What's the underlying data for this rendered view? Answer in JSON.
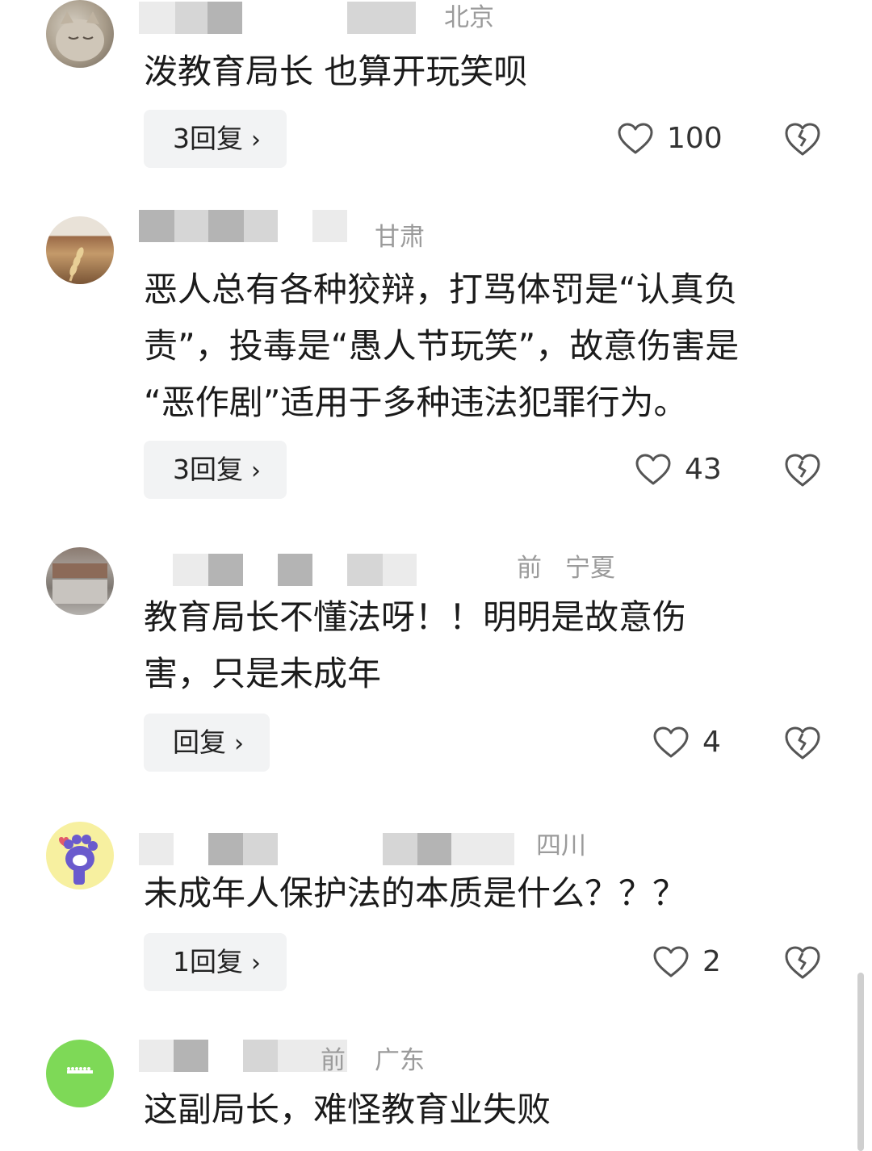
{
  "comments": [
    {
      "region": "北京",
      "text_lines": [
        "泼教育局长 也算开玩笑呗"
      ],
      "reply_label": "3回复",
      "likes": "100",
      "avatar_icon": "cat-avatar-icon"
    },
    {
      "region": "甘肃",
      "text_lines": [
        "恶人总有各种狡辩，打骂体罚是“认真负",
        "责”，投毒是“愚人节玩笑”，故意伤害是",
        "“恶作剧”适用于多种违法犯罪行为。"
      ],
      "reply_label": "3回复",
      "likes": "43",
      "avatar_icon": "wheat-avatar-icon"
    },
    {
      "region": "宁夏",
      "time_fragment": "前",
      "text_lines": [
        "教育局长不懂法呀！！明明是故意伤",
        "害，只是未成年"
      ],
      "reply_label": "回复",
      "likes": "4",
      "avatar_icon": "room-avatar-icon"
    },
    {
      "region": "四川",
      "text_lines": [
        "未成年人保护法的本质是什么？？？"
      ],
      "reply_label": "1回复",
      "likes": "2",
      "avatar_icon": "paw-avatar-icon"
    },
    {
      "region": "广东",
      "time_fragment": "前",
      "text_lines": [
        "这副局长，难怪教育业失败"
      ],
      "avatar_icon": "green-avatar-icon"
    }
  ],
  "icons": {
    "like": "heart-outline-icon",
    "dislike": "broken-heart-icon",
    "chevron": "›"
  },
  "colors": {
    "text": "#1b1b1b",
    "meta": "#9b9b9b",
    "reply_bg": "#f2f3f4",
    "icon": "#555555"
  }
}
